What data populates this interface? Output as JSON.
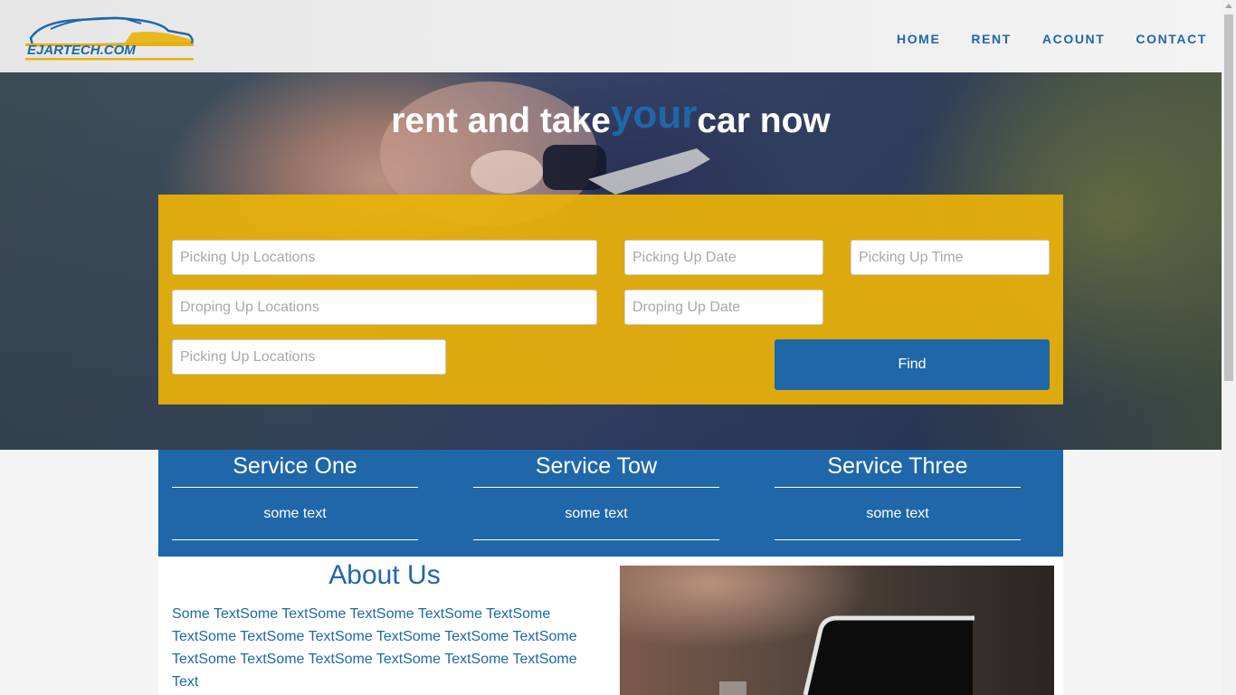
{
  "header": {
    "logo_text": "EJARTECH.COM",
    "nav": [
      "HOME",
      "RENT",
      "ACOUNT",
      "CONTACT"
    ]
  },
  "hero": {
    "title_before": "rent and take",
    "title_accent": "your",
    "title_after": "car now"
  },
  "form": {
    "pickup_location_placeholder": "Picking Up Locations",
    "pickup_date_placeholder": "Picking Up Date",
    "pickup_time_placeholder": "Picking Up Time",
    "dropoff_location_placeholder": "Droping Up Locations",
    "dropoff_date_placeholder": "Droping Up Date",
    "extra_location_placeholder": "Picking Up Locations",
    "find_label": "Find"
  },
  "services": [
    {
      "title": "Service One",
      "text": "some text"
    },
    {
      "title": "Service Tow",
      "text": "some text"
    },
    {
      "title": "Service Three",
      "text": "some text"
    }
  ],
  "about": {
    "title": "About Us",
    "text": "Some TextSome TextSome TextSome TextSome TextSome TextSome TextSome TextSome TextSome TextSome TextSome TextSome TextSome TextSome TextSome TextSome TextSome Text"
  },
  "colors": {
    "brand_blue": "#1f67a9",
    "form_yellow": "#e9b20a"
  }
}
